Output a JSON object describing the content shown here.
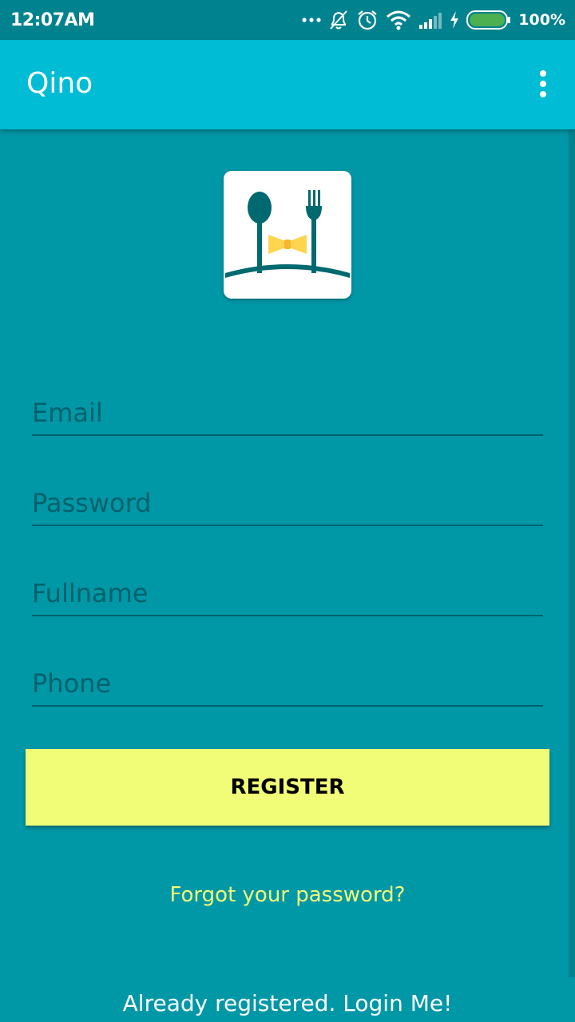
{
  "status_bar": {
    "time": "12:07AM",
    "battery_percent": "100%",
    "icons": [
      "more-dots-icon",
      "notifications-off-icon",
      "alarm-icon",
      "wifi-icon",
      "signal-icon",
      "charging-icon",
      "battery-icon"
    ]
  },
  "app_bar": {
    "title": "Qino",
    "menu_icon": "more-vert-icon"
  },
  "logo": {
    "icon": "spoon-fork-bowtie-logo"
  },
  "form": {
    "email_placeholder": "Email",
    "password_placeholder": "Password",
    "fullname_placeholder": "Fullname",
    "phone_placeholder": "Phone",
    "register_label": "REGISTER"
  },
  "links": {
    "forgot_password": "Forgot your password?",
    "login": "Already registered. Login Me!"
  },
  "colors": {
    "background": "#0097a7",
    "app_bar": "#00bcd4",
    "status_bar": "#00838f",
    "accent": "#f2fd77"
  }
}
